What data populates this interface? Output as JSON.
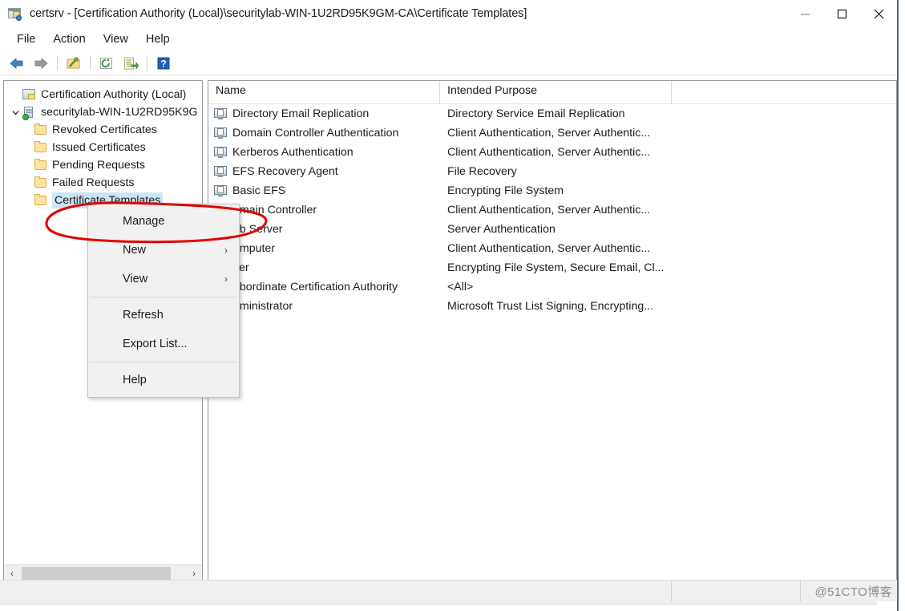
{
  "window": {
    "title": "certsrv - [Certification Authority (Local)\\securitylab-WIN-1U2RD95K9GM-CA\\Certificate Templates]",
    "icon": "certification-authority-icon",
    "minimize_label": "–",
    "maximize_label": "□",
    "close_label": "✕"
  },
  "menubar": {
    "items": [
      {
        "label": "File",
        "name": "menu-file"
      },
      {
        "label": "Action",
        "name": "menu-action"
      },
      {
        "label": "View",
        "name": "menu-view"
      },
      {
        "label": "Help",
        "name": "menu-help"
      }
    ]
  },
  "toolbar": {
    "buttons": [
      {
        "name": "back-icon",
        "title": "Back"
      },
      {
        "name": "forward-icon",
        "title": "Forward"
      },
      {
        "name": "show-hide-console-tree-icon",
        "title": "Show/Hide Console Tree"
      },
      {
        "name": "refresh-icon",
        "title": "Refresh"
      },
      {
        "name": "export-list-icon",
        "title": "Export List"
      },
      {
        "name": "help-icon",
        "title": "Help"
      }
    ]
  },
  "tree": {
    "root": {
      "label": "Certification Authority (Local)",
      "icon": "certification-authority-icon"
    },
    "server": {
      "label": "securitylab-WIN-1U2RD95K9G",
      "icon": "ca-server-icon",
      "expander": "⌄"
    },
    "children": [
      {
        "label": "Revoked Certificates",
        "icon": "folder-icon",
        "selected": false
      },
      {
        "label": "Issued Certificates",
        "icon": "folder-icon",
        "selected": false
      },
      {
        "label": "Pending Requests",
        "icon": "folder-icon",
        "selected": false
      },
      {
        "label": "Failed Requests",
        "icon": "folder-icon",
        "selected": false
      },
      {
        "label": "Certificate Templates",
        "icon": "folder-icon",
        "selected": true
      }
    ],
    "hscroll": {
      "left_arrow": "‹",
      "right_arrow": "›"
    }
  },
  "listview": {
    "columns": [
      {
        "label": "Name",
        "name": "column-header-name"
      },
      {
        "label": "Intended Purpose",
        "name": "column-header-intended-purpose"
      },
      {
        "label": "",
        "name": "column-header-filler"
      }
    ],
    "rows": [
      {
        "name": "Directory Email Replication",
        "purpose": "Directory Service Email Replication",
        "occluded": false
      },
      {
        "name": "Domain Controller Authentication",
        "purpose": "Client Authentication, Server Authentic...",
        "occluded": false
      },
      {
        "name": "Kerberos Authentication",
        "purpose": "Client Authentication, Server Authentic...",
        "occluded": false
      },
      {
        "name": "EFS Recovery Agent",
        "purpose": "File Recovery",
        "occluded": false
      },
      {
        "name": "Basic EFS",
        "purpose": "Encrypting File System",
        "occluded": false
      },
      {
        "name": "Domain Controller",
        "visible_name": "omain Controller",
        "purpose": "Client Authentication, Server Authentic...",
        "occluded": true
      },
      {
        "name": "Web Server",
        "visible_name": "eb Server",
        "purpose": "Server Authentication",
        "occluded": true
      },
      {
        "name": "Computer",
        "visible_name": "omputer",
        "purpose": "Client Authentication, Server Authentic...",
        "occluded": true
      },
      {
        "name": "User",
        "visible_name": "ser",
        "purpose": "Encrypting File System, Secure Email, Cl...",
        "occluded": true
      },
      {
        "name": "Subordinate Certification Authority",
        "visible_name": "ubordinate Certification Authority",
        "purpose": "<All>",
        "occluded": true
      },
      {
        "name": "Administrator",
        "visible_name": "dministrator",
        "purpose": "Microsoft Trust List Signing, Encrypting...",
        "occluded": true
      }
    ]
  },
  "context_menu": {
    "items": [
      {
        "label": "Manage",
        "name": "context-menu-manage",
        "submenu": false,
        "highlighted": true
      },
      {
        "label": "New",
        "name": "context-menu-new",
        "submenu": true,
        "arrow": "›"
      },
      {
        "label": "View",
        "name": "context-menu-view",
        "submenu": true,
        "arrow": "›"
      },
      {
        "label": "Refresh",
        "name": "context-menu-refresh",
        "submenu": false
      },
      {
        "label": "Export List...",
        "name": "context-menu-export-list",
        "submenu": false
      },
      {
        "label": "Help",
        "name": "context-menu-help",
        "submenu": false
      }
    ]
  },
  "annotation": {
    "shape": "ellipse",
    "color": "#e00000",
    "target": "Manage"
  },
  "statusbar": {
    "text": "",
    "watermark": "@51CTO博客"
  },
  "colors": {
    "selection": "#cce4f7",
    "menu_bg": "#f1f1f1",
    "annotation_red": "#e00000",
    "window_frame_blue": "#3b6ea5",
    "status_bg": "#f0f0f0"
  }
}
